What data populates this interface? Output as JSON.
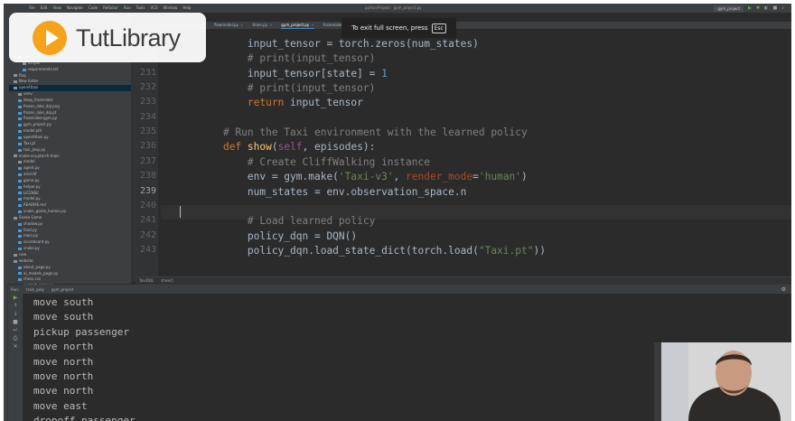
{
  "window": {
    "title": "pythonProject - gym_project.py"
  },
  "menu": [
    "File",
    "Edit",
    "View",
    "Navigate",
    "Code",
    "Refactor",
    "Run",
    "Tools",
    "VCS",
    "Window",
    "Help"
  ],
  "toolbar": {
    "run_config": "gym_project",
    "icons": [
      "run-icon",
      "debug-icon",
      "coverage-icon",
      "stop-icon",
      "search-icon"
    ]
  },
  "tabs": [
    {
      "label": "flowmodel.py",
      "active": false
    },
    {
      "label": "Xrom.py",
      "active": false
    },
    {
      "label": "gym_project.py",
      "active": true
    },
    {
      "label": "frozenlake-gym.py",
      "active": false
    }
  ],
  "fullscreen_hint": {
    "text": "To exit full screen, press",
    "key": "Esc"
  },
  "logo": {
    "brand_color": "#f5a31a",
    "text": "TutLibrary"
  },
  "project_tree": [
    "venv",
    "scripts",
    "requirements.txt",
    "flaq",
    "New folder",
    "openAItaxi",
    "venv",
    "deep_frozenlake",
    "frozen_lake_dql.png",
    "frozen_lake_dql.pt",
    "frozenlake-gym.py",
    "gym_project.py",
    "model.pth",
    "openAItaxi.py",
    "Taxi.pt",
    "taxi_jeep.py",
    "snake-ai-pytorch-main",
    "model",
    "agent.py",
    "arial.ttf",
    "game.py",
    "helper.py",
    "LICENSE",
    "model.py",
    "README.md",
    "snake_game_human.py",
    "Snake Game",
    "shadow.py",
    "food.py",
    "main.py",
    "scoreboard.py",
    "snake.py",
    "new",
    "website",
    "about_page.py",
    "ai_models_page.py",
    "chess.csv",
    "contact_page.py"
  ],
  "editor": {
    "current_line": 239,
    "lines": [
      {
        "no": 229,
        "code": "        input_tensor = torch.zeros(num_states)"
      },
      {
        "no": 230,
        "code": "        # print(input_tensor)"
      },
      {
        "no": 231,
        "code": "        input_tensor[state] = 1"
      },
      {
        "no": 232,
        "code": "        # print(input_tensor)"
      },
      {
        "no": 233,
        "code": "        return input_tensor"
      },
      {
        "no": 234,
        "code": ""
      },
      {
        "no": 235,
        "code": "    # Run the Taxi environment with the learned policy"
      },
      {
        "no": 236,
        "code": "    def show(self, episodes):"
      },
      {
        "no": 237,
        "code": "        # Create CliffWalking instance"
      },
      {
        "no": 238,
        "code": "        env = gym.make('Taxi-v3', render_mode='human')"
      },
      {
        "no": 239,
        "code": "        num_states = env.observation_space.n"
      },
      {
        "no": 240,
        "code": ""
      },
      {
        "no": 241,
        "code": "        # Load learned policy"
      },
      {
        "no": 242,
        "code": "        policy_dqn = DQN()"
      },
      {
        "no": 243,
        "code": "        policy_dqn.load_state_dict(torch.load(\"Taxi.pt\"))"
      }
    ]
  },
  "breadcrumbs": [
    "TaxiDQL",
    "show()"
  ],
  "run_panel": {
    "label": "Run:",
    "tabs": [
      "train_poly",
      "gym_project"
    ],
    "output": [
      "move south",
      "move south",
      "pickup passenger",
      "move north",
      "move north",
      "move north",
      "move north",
      "move east",
      "dropoff passenger"
    ]
  },
  "colors": {
    "keyword": "#cc7832",
    "function": "#ffc66d",
    "comment": "#808080",
    "string": "#6a8759",
    "number": "#6897bb",
    "parameter": "#aa4926",
    "self": "#94558d"
  }
}
